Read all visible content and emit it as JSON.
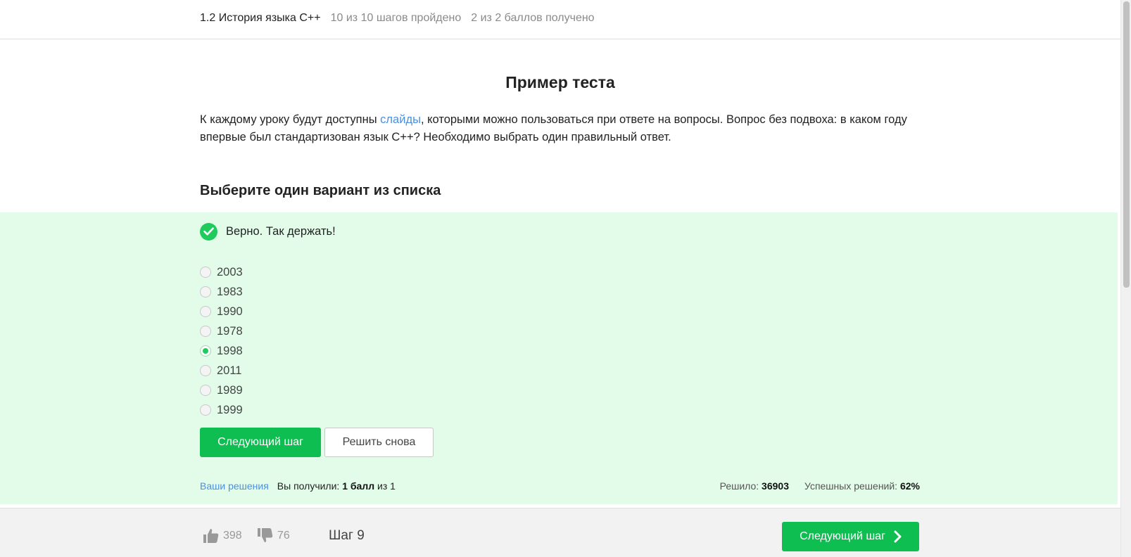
{
  "header": {
    "lesson_title": "1.2 История языка C++",
    "steps_progress": "10 из 10 шагов пройдено",
    "points_progress": "2 из 2 баллов  получено"
  },
  "step": {
    "title": "Пример теста",
    "intro_before_link": "К каждому уроку будут доступны ",
    "intro_link": "слайды",
    "intro_after_link": ", которыми можно пользоваться при ответе на вопросы. Вопрос без подвоха: в каком году впервые был стандартизован язык C++? Необходимо выбрать один правильный ответ."
  },
  "quiz": {
    "heading": "Выберите один вариант из списка",
    "feedback": "Верно. Так держать!",
    "options": [
      "2003",
      "1983",
      "1990",
      "1978",
      "1998",
      "2011",
      "1989",
      "1999"
    ],
    "selected": "1998",
    "next_button": "Следующий шаг",
    "retry_button": "Решить снова"
  },
  "stats": {
    "your_solutions": "Ваши решения",
    "received_prefix": "Вы получили:",
    "received_value": "1 балл",
    "received_suffix": "из 1",
    "solved_label": "Решило:",
    "solved_value": "36903",
    "success_label": "Успешных решений:",
    "success_value": "62%"
  },
  "footer": {
    "likes": "398",
    "dislikes": "76",
    "step_label": "Шаг 9",
    "next_button": "Следующий шаг"
  },
  "colors": {
    "accent_green": "#0fbe50",
    "success_bg": "#e3fce9",
    "link_blue": "#4a90e2"
  },
  "icons": [
    "check-icon",
    "thumbs-up-icon",
    "thumbs-down-icon",
    "chevron-right-icon"
  ]
}
